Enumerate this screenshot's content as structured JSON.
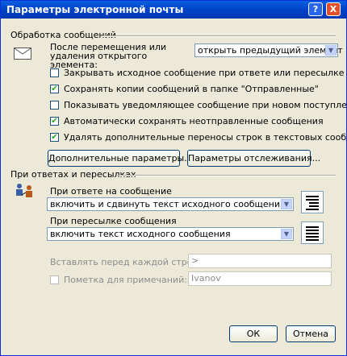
{
  "window": {
    "title": "Параметры электронной почты",
    "help_glyph": "?",
    "close_glyph": "X"
  },
  "handling": {
    "group_label": "Обработка сообщений",
    "after_move_label": "После перемещения или удаления открытого элемента:",
    "after_move_value": "открыть предыдущий элемент",
    "options": [
      {
        "label": "Закрывать исходное сообщение при ответе или пересылке",
        "checked": false
      },
      {
        "label": "Сохранять копии сообщений в папке \"Отправленные\"",
        "checked": true
      },
      {
        "label": "Показывать уведомляющее сообщение при новом поступлении",
        "checked": false
      },
      {
        "label": "Автоматически сохранять неотправленные сообщения",
        "checked": true
      },
      {
        "label": "Удалять дополнительные переносы строк в текстовых сообщениях",
        "checked": true
      }
    ],
    "advanced_button": "Дополнительные параметры...",
    "tracking_button": "Параметры отслеживания..."
  },
  "replies": {
    "group_label": "При ответах и пересылках",
    "reply_label": "При ответе на сообщение",
    "reply_value": "включить и сдвинуть текст исходного сообщения",
    "forward_label": "При пересылке сообщения",
    "forward_value": "включить текст исходного сообщения",
    "prefix_label": "Вставлять перед каждой строкой:",
    "prefix_value": ">",
    "comments_label": "Пометка для примечаний:",
    "comments_value": "Ivanov",
    "comments_checked": false
  },
  "footer": {
    "ok": "ОК",
    "cancel": "Отмена"
  },
  "icons": {
    "envelope": "envelope-icon",
    "reply_people": "reply-people-icon",
    "reply_format": "reply-format-preview-icon",
    "forward_format": "forward-format-preview-icon"
  }
}
